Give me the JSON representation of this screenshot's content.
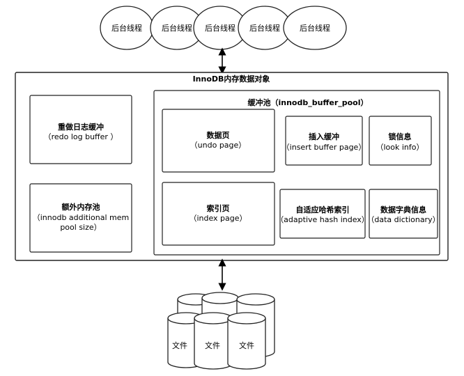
{
  "threads": [
    "后台线程",
    "后台线程",
    "后台线程",
    "后台线程",
    "后台线程"
  ],
  "innodb_title": "InnoDB内存数据对象",
  "redo_log": {
    "title": "重做日志缓冲",
    "subtitle": "（redo log buffer ）"
  },
  "additional_mem": {
    "title": "额外内存池",
    "line2": "（innodb additional mem",
    "line3": "pool size）"
  },
  "buffer_pool": {
    "title": "缓冲池（innodb_buffer_pool）"
  },
  "data_page": {
    "title": "数据页",
    "subtitle": "（undo page）"
  },
  "index_page": {
    "title": "索引页",
    "subtitle": "（index page）"
  },
  "insert_buffer": {
    "title": "插入缓冲",
    "subtitle": "（insert buffer page）"
  },
  "lock_info": {
    "title": "锁信息",
    "subtitle": "（look info）"
  },
  "adaptive_hash": {
    "title": "自适应哈希索引",
    "subtitle": "（adaptive hash index）"
  },
  "data_dict": {
    "title": "数据字典信息",
    "subtitle": "（data dictionary）"
  },
  "files": [
    "文件",
    "文件",
    "文件"
  ]
}
